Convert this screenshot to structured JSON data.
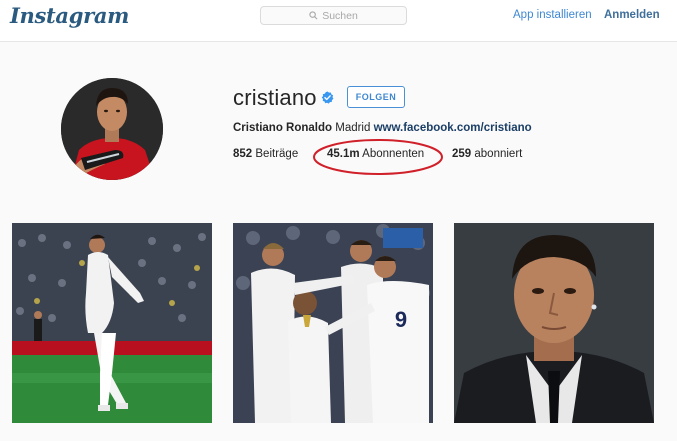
{
  "header": {
    "logo": "Instagram",
    "search_placeholder": "Suchen",
    "app_install": "App installieren",
    "login": "Anmelden"
  },
  "profile": {
    "username": "cristiano",
    "follow_button": "FOLGEN",
    "full_name": "Cristiano Ronaldo",
    "location": "Madrid",
    "website": "www.facebook.com/cristiano",
    "posts_count": "852",
    "posts_label": "Beiträge",
    "followers_count": "45.1m",
    "followers_label": "Abonnenten",
    "following_count": "259",
    "following_label": "abonniert"
  },
  "colors": {
    "link": "#3f88d1",
    "verified_badge": "#3897f0",
    "highlight": "#d0202a"
  },
  "icons": [
    "instagram-logo",
    "search-icon",
    "verified-badge-icon"
  ],
  "photos": [
    {
      "name": "celebration-photo"
    },
    {
      "name": "team-hug-photo"
    },
    {
      "name": "portrait-photo"
    }
  ]
}
